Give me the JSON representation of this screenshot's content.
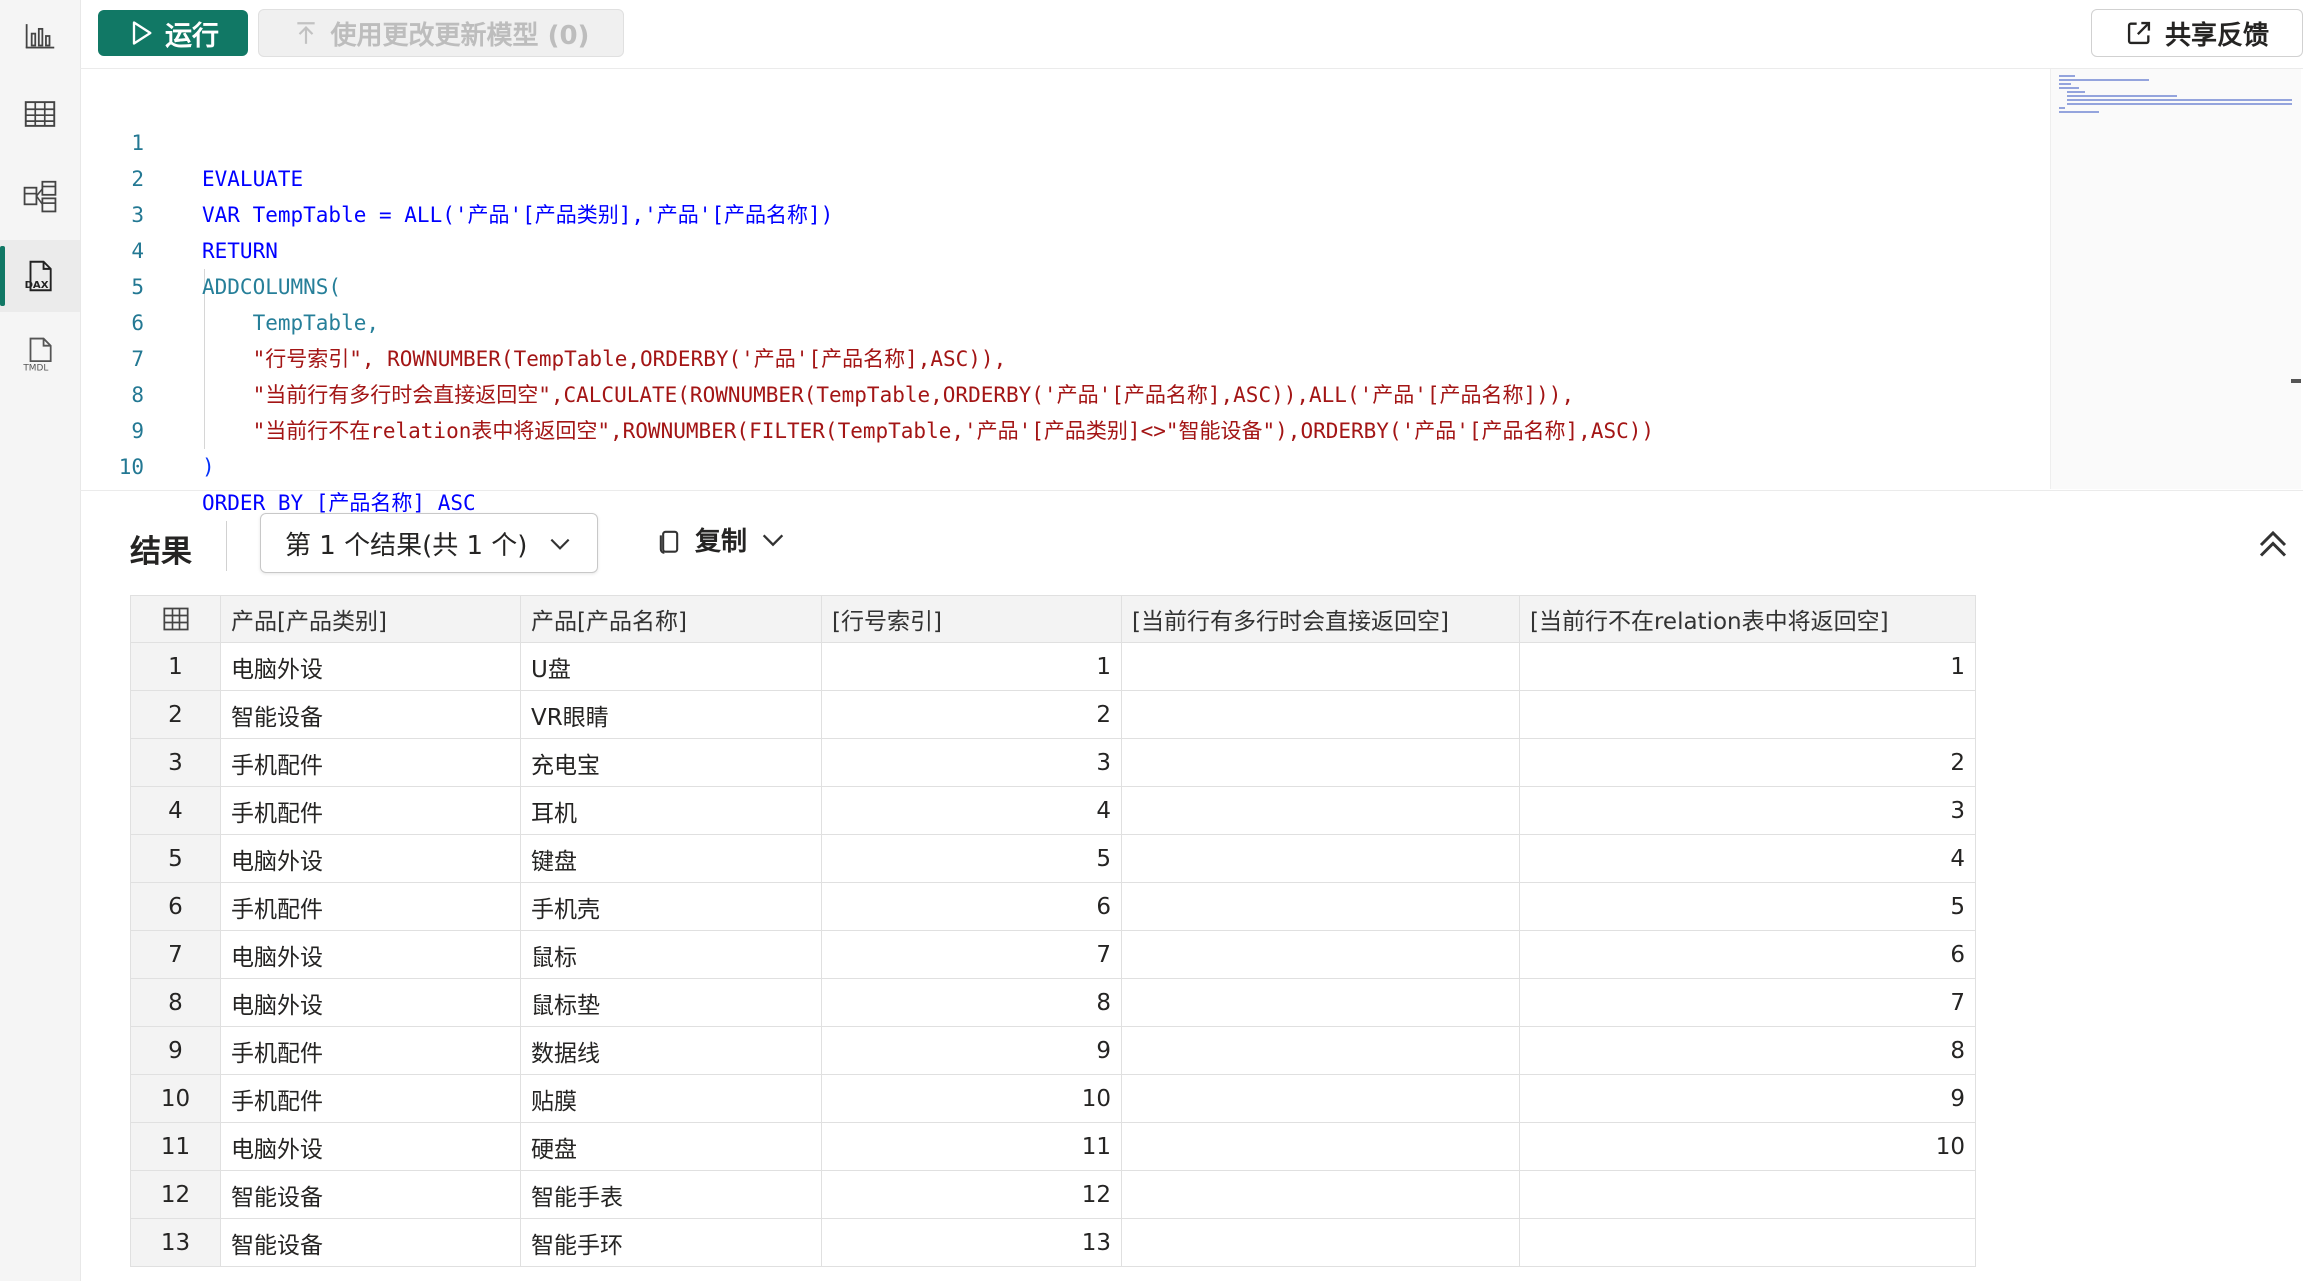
{
  "toolbar": {
    "run_label": "运行",
    "apply_label": "使用更改更新模型 (0)",
    "share_label": "共享反馈"
  },
  "rail": {
    "items": [
      "report-view",
      "table-view",
      "model-view",
      "dax-query-view",
      "tmdl-view"
    ],
    "active": "dax-query-view",
    "dax_text": "DAX",
    "tmdl_text": "TMDL"
  },
  "editor": {
    "line_numbers": [
      "1",
      "2",
      "3",
      "4",
      "5",
      "6",
      "7",
      "8",
      "9",
      "10"
    ],
    "lines": [
      "EVALUATE",
      "VAR TempTable = ALL('产品'[产品类别],'产品'[产品名称])",
      "RETURN",
      "ADDCOLUMNS(",
      "    TempTable,",
      "    \"行号索引\", ROWNUMBER(TempTable,ORDERBY('产品'[产品名称],ASC)),",
      "    \"当前行有多行时会直接返回空\",CALCULATE(ROWNUMBER(TempTable,ORDERBY('产品'[产品名称],ASC)),ALL('产品'[产品名称])),",
      "    \"当前行不在relation表中将返回空\",ROWNUMBER(FILTER(TempTable,'产品'[产品类别]<>\"智能设备\"),ORDERBY('产品'[产品名称],ASC))",
      ")",
      "ORDER BY [产品名称] ASC"
    ]
  },
  "results": {
    "title": "结果",
    "selector": "第 1 个结果(共 1 个)",
    "copy_label": "复制",
    "columns": [
      "产品[产品类别]",
      "产品[产品名称]",
      "[行号索引]",
      "[当前行有多行时会直接返回空]",
      "[当前行不在relation表中将返回空]"
    ],
    "rows": [
      [
        "1",
        "电脑外设",
        "U盘",
        "1",
        "",
        "1"
      ],
      [
        "2",
        "智能设备",
        "VR眼睛",
        "2",
        "",
        ""
      ],
      [
        "3",
        "手机配件",
        "充电宝",
        "3",
        "",
        "2"
      ],
      [
        "4",
        "手机配件",
        "耳机",
        "4",
        "",
        "3"
      ],
      [
        "5",
        "电脑外设",
        "键盘",
        "5",
        "",
        "4"
      ],
      [
        "6",
        "手机配件",
        "手机壳",
        "6",
        "",
        "5"
      ],
      [
        "7",
        "电脑外设",
        "鼠标",
        "7",
        "",
        "6"
      ],
      [
        "8",
        "电脑外设",
        "鼠标垫",
        "8",
        "",
        "7"
      ],
      [
        "9",
        "手机配件",
        "数据线",
        "9",
        "",
        "8"
      ],
      [
        "10",
        "手机配件",
        "贴膜",
        "10",
        "",
        "9"
      ],
      [
        "11",
        "电脑外设",
        "硬盘",
        "11",
        "",
        "10"
      ],
      [
        "12",
        "智能设备",
        "智能手表",
        "12",
        "",
        ""
      ],
      [
        "13",
        "智能设备",
        "智能手环",
        "13",
        "",
        ""
      ]
    ]
  },
  "colors": {
    "accent": "#117865",
    "keyword": "#0000ff",
    "function": "#267f99",
    "string": "#a31515"
  }
}
